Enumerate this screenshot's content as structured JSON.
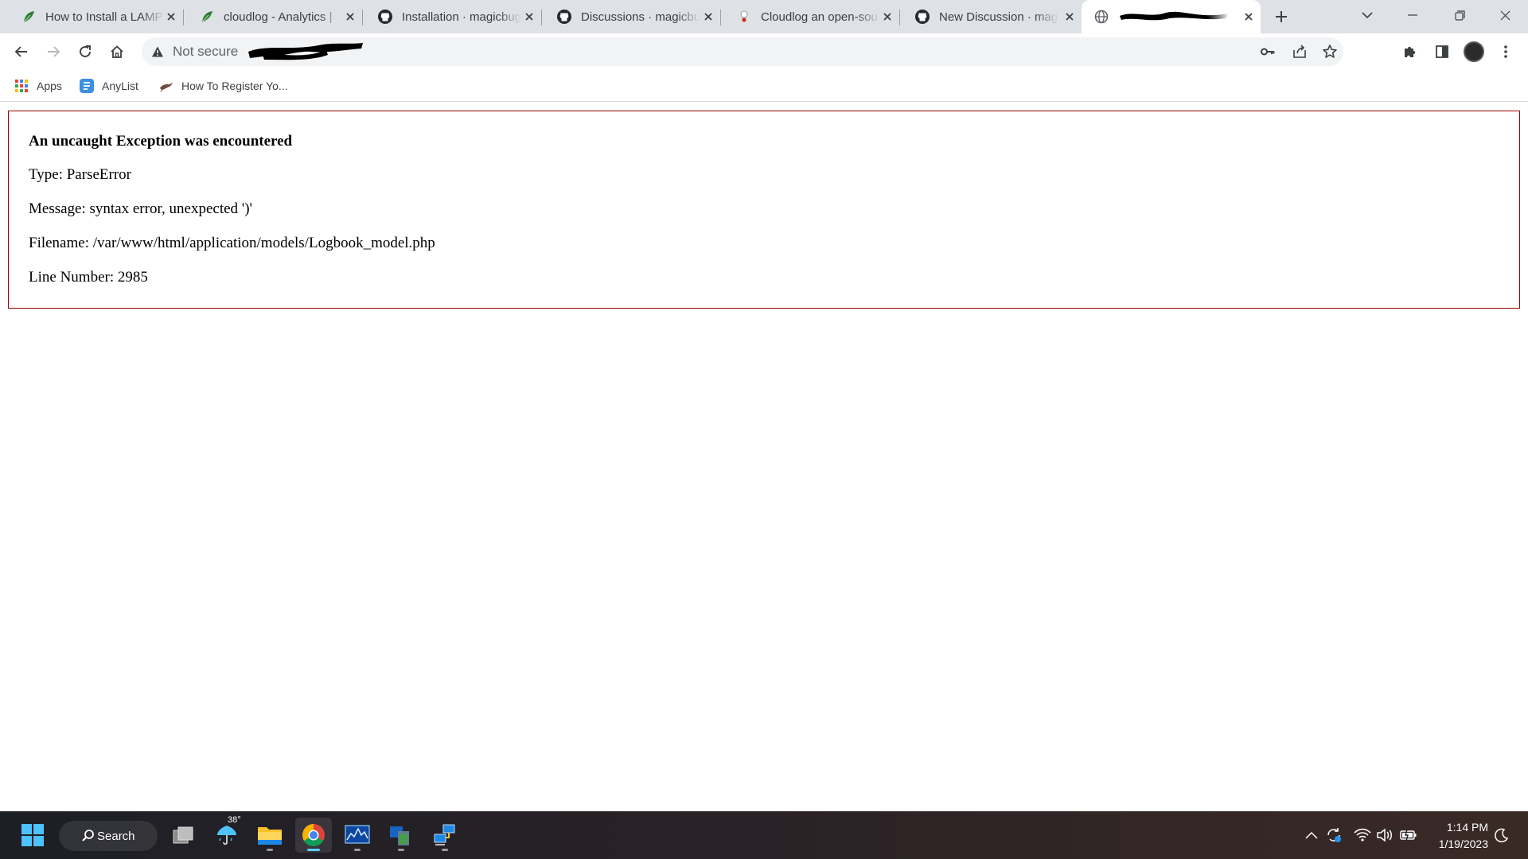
{
  "browser": {
    "tabs": [
      {
        "title": "How to Install a LAMP",
        "icon": "leaf-favicon-icon",
        "active": false
      },
      {
        "title": "cloudlog - Analytics | ",
        "icon": "leaf-favicon-icon",
        "active": false
      },
      {
        "title": "Installation · magicbug",
        "icon": "github-icon",
        "active": false
      },
      {
        "title": "Discussions · magicbug",
        "icon": "github-icon",
        "active": false
      },
      {
        "title": "Cloudlog an open-sou",
        "icon": "cloudlog-favicon-icon",
        "active": false
      },
      {
        "title": "New Discussion · mag",
        "icon": "github-icon",
        "active": false
      },
      {
        "title": "",
        "icon": "globe-icon",
        "active": true
      }
    ],
    "address_bar": {
      "security_label": "Not secure",
      "url_redacted": true
    },
    "bookmarks": [
      {
        "label": "Apps",
        "icon": "apps-grid-icon"
      },
      {
        "label": "AnyList",
        "icon": "anylist-icon"
      },
      {
        "label": "How To Register Yo...",
        "icon": "bird-icon"
      }
    ]
  },
  "page": {
    "heading": "An uncaught Exception was encountered",
    "type_line": "Type: ParseError",
    "message_line": "Message: syntax error, unexpected ')'",
    "filename_line": "Filename: /var/www/html/application/models/Logbook_model.php",
    "line_number_line": "Line Number: 2985"
  },
  "taskbar": {
    "search_label": "Search",
    "weather_temp": "38°",
    "time": "1:14 PM",
    "date": "1/19/2023",
    "accent_color": "#60cdff"
  }
}
